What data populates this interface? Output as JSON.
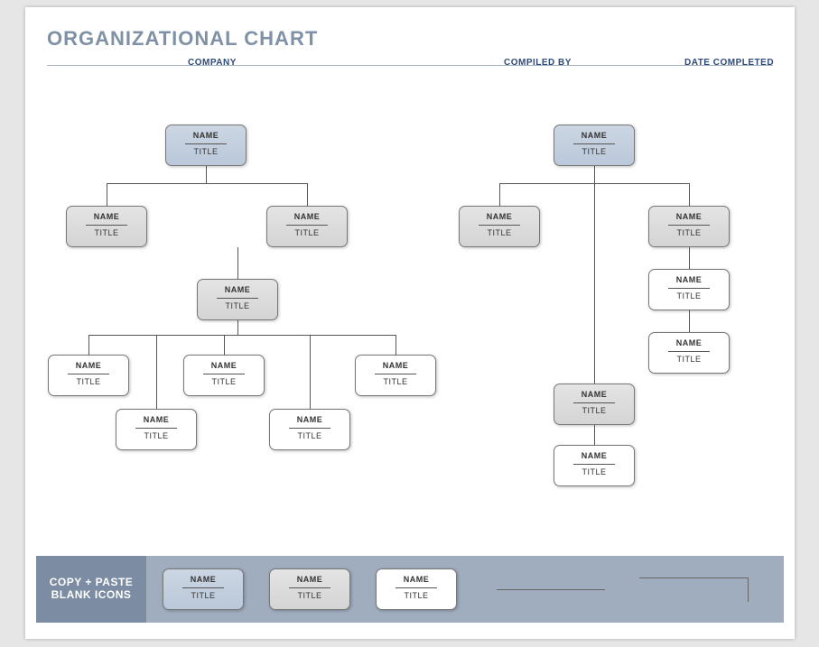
{
  "title": "ORGANIZATIONAL CHART",
  "headers": {
    "company": "COMPANY",
    "compiled": "COMPILED BY",
    "date": "DATE COMPLETED"
  },
  "placeholder": {
    "name": "NAME",
    "title": "TITLE"
  },
  "footer": {
    "label_line1": "COPY + PASTE",
    "label_line2": "BLANK ICONS"
  },
  "colors": {
    "blue": "#bac8da",
    "grey": "#d8d8d8",
    "accent": "#2d4a7a"
  }
}
